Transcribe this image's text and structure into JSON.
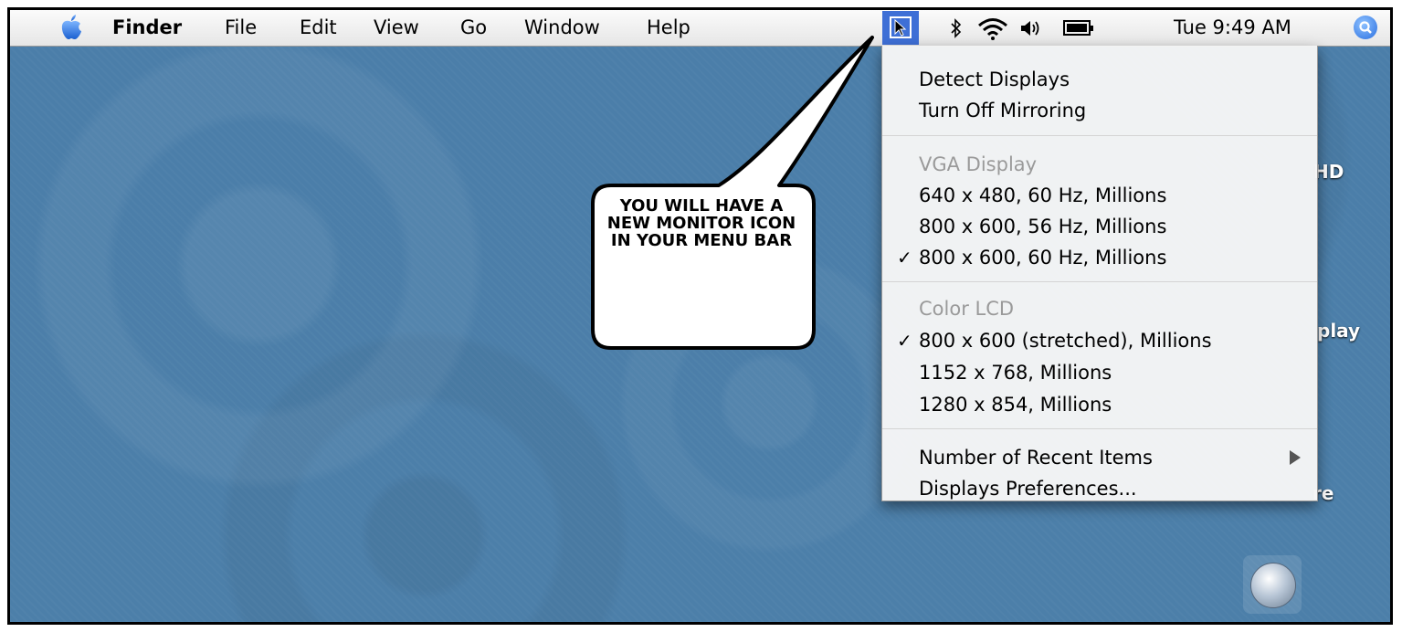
{
  "menubar": {
    "app_name": "Finder",
    "menus": [
      "File",
      "Edit",
      "View",
      "Go",
      "Window",
      "Help"
    ],
    "clock": "Tue 9:49 AM",
    "icons": [
      "apple-icon",
      "displays-icon",
      "bluetooth-icon",
      "wifi-icon",
      "volume-icon",
      "battery-icon",
      "spotlight-icon"
    ]
  },
  "displays_menu": {
    "top_items": [
      "Detect Displays",
      "Turn Off Mirroring"
    ],
    "vga": {
      "header": "VGA Display",
      "modes": [
        "640 x 480, 60 Hz, Millions",
        "800 x 600, 56 Hz, Millions",
        "800 x 600, 60 Hz, Millions"
      ],
      "selected_index": 2
    },
    "lcd": {
      "header": "Color LCD",
      "modes": [
        "800 x 600 (stretched), Millions",
        "1152 x 768, Millions",
        "1280 x 854, Millions"
      ],
      "selected_index": 0
    },
    "bottom_items": [
      "Number of Recent Items",
      "Displays Preferences..."
    ],
    "checkmark": "✓"
  },
  "desktop": {
    "icon_labels": [
      "HD",
      "play",
      "re"
    ]
  },
  "callout": {
    "text": "YOU WILL HAVE A NEW MONITOR ICON IN YOUR MENU BAR"
  },
  "colors": {
    "desktop": "#4f80aa",
    "menu_highlight": "#3e6fd6"
  }
}
